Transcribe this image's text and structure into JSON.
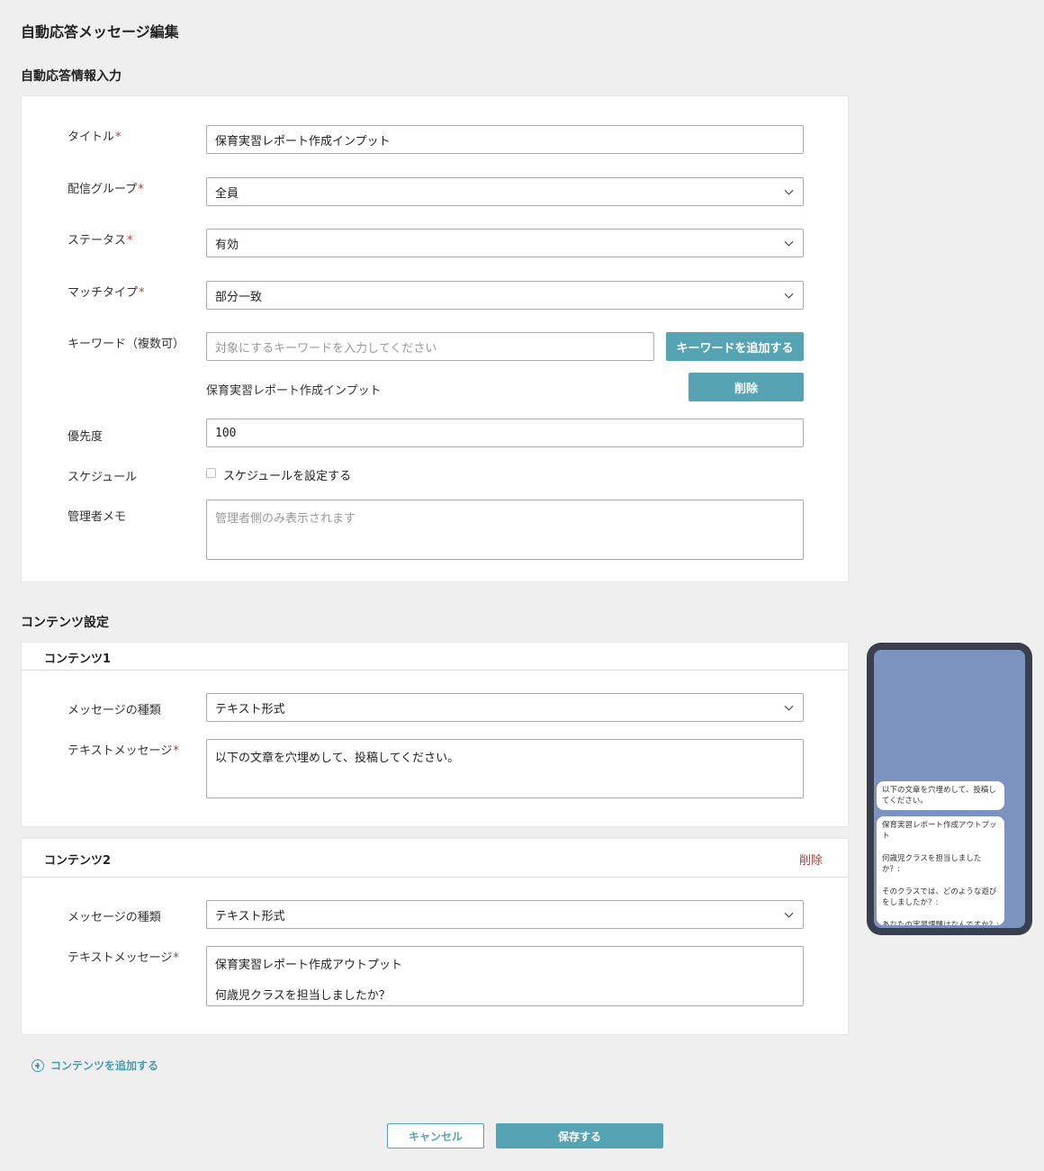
{
  "page_title": "自動応答メッセージ編集",
  "info_section": {
    "title": "自動応答情報入力",
    "title_label": "タイトル",
    "title_value": "保育実習レポート作成インプット",
    "group_label": "配信グループ",
    "group_value": "全員",
    "status_label": "ステータス",
    "status_value": "有効",
    "match_label": "マッチタイプ",
    "match_value": "部分一致",
    "keyword_label": "キーワード（複数可）",
    "keyword_placeholder": "対象にするキーワードを入力してください",
    "keyword_add_button": "キーワードを追加する",
    "keywords": [
      {
        "text": "保育実習レポート作成インプット",
        "delete_label": "削除"
      }
    ],
    "priority_label": "優先度",
    "priority_value": "100",
    "schedule_label": "スケジュール",
    "schedule_checkbox_label": "スケジュールを設定する",
    "memo_label": "管理者メモ",
    "memo_placeholder": "管理者側のみ表示されます",
    "required_mark": "*"
  },
  "content_section": {
    "title": "コンテンツ設定",
    "contents": [
      {
        "name": "コンテンツ1",
        "type_label": "メッセージの種類",
        "type_value": "テキスト形式",
        "text_label": "テキストメッセージ",
        "text_value": "以下の文章を穴埋めして、投稿してください。"
      },
      {
        "name": "コンテンツ2",
        "delete_label": "削除",
        "type_label": "メッセージの種類",
        "type_value": "テキスト形式",
        "text_label": "テキストメッセージ",
        "text_line1": "保育実習レポート作成アウトプット",
        "text_line2": "何歳児クラスを担当しましたか？"
      }
    ],
    "add_content_label": "コンテンツを追加する"
  },
  "preview": {
    "bubble1": "以下の文章を穴埋めして、投稿してください。",
    "bubble2": "保育実習レポート作成アウトプット\n\n何歳児クラスを担当しましたか？:\n\nそのクラスでは、どのような遊びをしましたか？:\n\nあなたの実習課題はなんですか？:"
  },
  "footer": {
    "cancel_label": "キャンセル",
    "save_label": "保存する"
  },
  "colors": {
    "accent": "#56a3b3",
    "required": "#c0392b",
    "delete_text": "#b23a3a",
    "phone_frame": "#3a3f4e",
    "phone_screen": "#7b93be"
  }
}
